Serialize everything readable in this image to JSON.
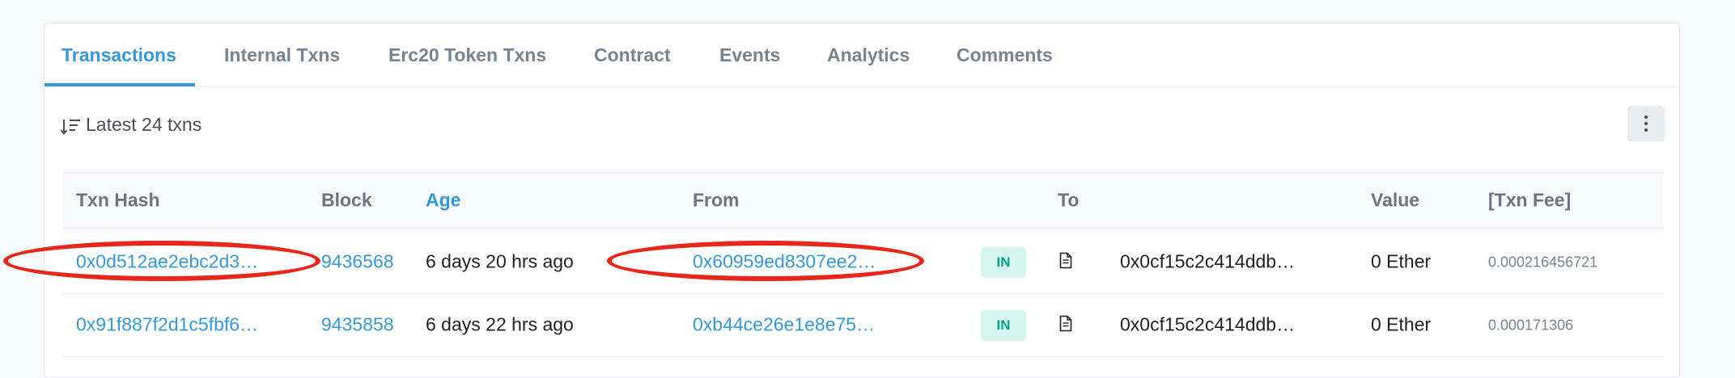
{
  "tabs": [
    {
      "label": "Transactions",
      "active": true
    },
    {
      "label": "Internal Txns",
      "active": false
    },
    {
      "label": "Erc20 Token Txns",
      "active": false
    },
    {
      "label": "Contract",
      "active": false
    },
    {
      "label": "Events",
      "active": false
    },
    {
      "label": "Analytics",
      "active": false
    },
    {
      "label": "Comments",
      "active": false
    }
  ],
  "summary": {
    "sort_icon": "sort-descending-icon",
    "latest_label": "Latest 24 txns",
    "more_icon": "vertical-ellipsis-icon"
  },
  "table": {
    "headers": {
      "txn_hash": "Txn Hash",
      "block": "Block",
      "age": "Age",
      "from": "From",
      "to": "To",
      "value": "Value",
      "txn_fee": "[Txn Fee]"
    },
    "rows": [
      {
        "txn_hash": "0x0d512ae2ebc2d3…",
        "block": "9436568",
        "age": "6 days 20 hrs ago",
        "from": "0x60959ed8307ee2…",
        "direction": "IN",
        "to_icon": "contract-document-icon",
        "to": "0x0cf15c2c414ddb…",
        "value": "0 Ether",
        "txn_fee": "0.000216456721",
        "highlighted": true
      },
      {
        "txn_hash": "0x91f887f2d1c5fbf6…",
        "block": "9435858",
        "age": "6 days 22 hrs ago",
        "from": "0xb44ce26e1e8e75…",
        "direction": "IN",
        "to_icon": "contract-document-icon",
        "to": "0x0cf15c2c414ddb…",
        "value": "0 Ether",
        "txn_fee": "0.000171306",
        "highlighted": false
      }
    ]
  },
  "colors": {
    "accent": "#3498db",
    "badge_in_text": "#00a186",
    "badge_in_bg": "#d7f5ef",
    "annotation_red": "#e8261a"
  }
}
